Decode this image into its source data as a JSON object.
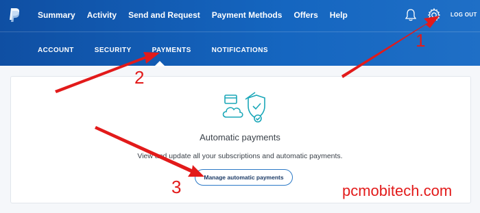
{
  "topnav": {
    "items": [
      "Summary",
      "Activity",
      "Send and Request",
      "Payment Methods",
      "Offers",
      "Help"
    ],
    "logout_label": "LOG OUT"
  },
  "subnav": {
    "items": [
      "ACCOUNT",
      "SECURITY",
      "PAYMENTS",
      "NOTIFICATIONS"
    ],
    "active": "PAYMENTS"
  },
  "card": {
    "title": "Automatic payments",
    "description": "View and update all your subscriptions and automatic payments.",
    "button_label": "Manage automatic payments"
  },
  "annotations": {
    "step1": "1",
    "step2": "2",
    "step3": "3",
    "watermark": "pcmobitech.com"
  },
  "icons": [
    "paypal-logo-icon",
    "bell-icon",
    "gear-icon",
    "cloud-shield-icon"
  ],
  "colors": {
    "header_blue": "#1566c0",
    "annotation_red": "#e21a1a",
    "button_border": "#2a78c6"
  }
}
